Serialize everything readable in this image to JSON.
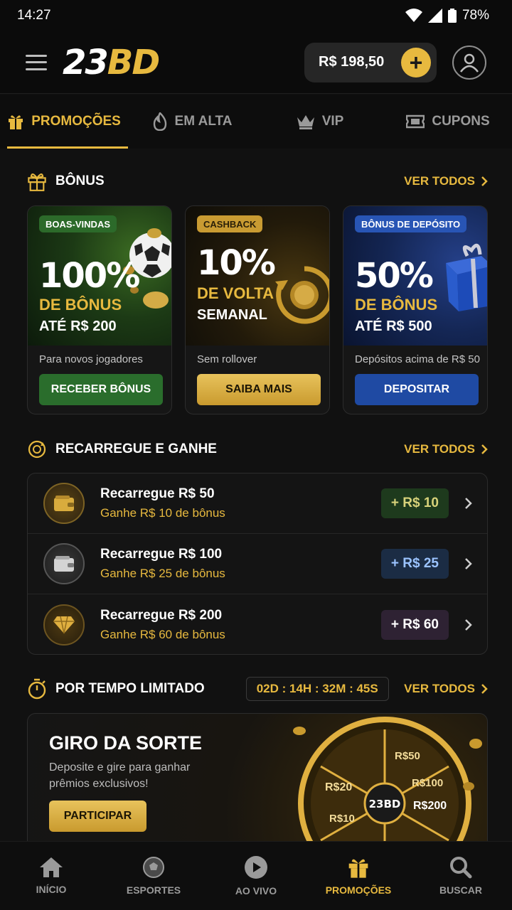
{
  "status": {
    "time": "14:27",
    "battery": "78%"
  },
  "header": {
    "logo_white": "23",
    "logo_gold": "BD",
    "balance": "R$ 198,50",
    "add_symbol": "+"
  },
  "tabs": [
    {
      "label": "PROMOÇÕES",
      "icon": "gift-icon",
      "active": true
    },
    {
      "label": "EM ALTA",
      "icon": "fire-icon",
      "active": false
    },
    {
      "label": "VIP",
      "icon": "crown-icon",
      "active": false
    },
    {
      "label": "CUPONS",
      "icon": "ticket-icon",
      "active": false
    }
  ],
  "bonus": {
    "title": "BÔNUS",
    "see_all": "VER TODOS",
    "cards": [
      {
        "tag": "BOAS-VINDAS",
        "big": "100%",
        "line1": "DE BÔNUS",
        "line2": "ATÉ R$ 200",
        "desc": "Para novos jogadores",
        "button": "RECEBER BÔNUS"
      },
      {
        "tag": "CASHBACK",
        "big": "10%",
        "line1": "DE VOLTA",
        "line2": "SEMANAL",
        "desc": "Sem rollover",
        "button": "SAIBA MAIS"
      },
      {
        "tag": "BÔNUS DE DEPÓSITO",
        "big": "50%",
        "line1": "DE BÔNUS",
        "line2": "ATÉ R$ 500",
        "desc": "Depósitos acima de R$ 50",
        "button": "DEPOSITAR"
      }
    ]
  },
  "recharge": {
    "title": "RECARREGUE E GANHE",
    "see_all": "VER TODOS",
    "items": [
      {
        "title": "Recarregue R$ 50",
        "sub": "Ganhe R$ 10 de bônus",
        "badge": "+ R$ 10"
      },
      {
        "title": "Recarregue R$ 100",
        "sub": "Ganhe R$ 25 de bônus",
        "badge": "+ R$ 25"
      },
      {
        "title": "Recarregue R$ 200",
        "sub": "Ganhe R$ 60 de bônus",
        "badge": "+ R$ 60"
      }
    ]
  },
  "limited": {
    "title": "POR TEMPO LIMITADO",
    "timer": "02D : 14H : 32M : 45S",
    "see_all": "VER TODOS",
    "card": {
      "title": "GIRO DA SORTE",
      "desc": "Deposite e gire para ganhar prêmios exclusivos!",
      "button": "PARTICIPAR",
      "wheel_center": "23BD",
      "wheel_labels": [
        "R$50",
        "R$100",
        "R$200",
        "R$20",
        "R$10"
      ]
    }
  },
  "bottom_nav": [
    {
      "label": "INÍCIO",
      "icon": "home-icon",
      "active": false
    },
    {
      "label": "ESPORTES",
      "icon": "soccer-ball-icon",
      "active": false
    },
    {
      "label": "AO VIVO",
      "icon": "play-icon",
      "active": false
    },
    {
      "label": "PROMOÇÕES",
      "icon": "gift-icon",
      "active": true
    },
    {
      "label": "BUSCAR",
      "icon": "search-icon",
      "active": false
    }
  ],
  "colors": {
    "accent": "#e7b93f",
    "background": "#111111"
  }
}
